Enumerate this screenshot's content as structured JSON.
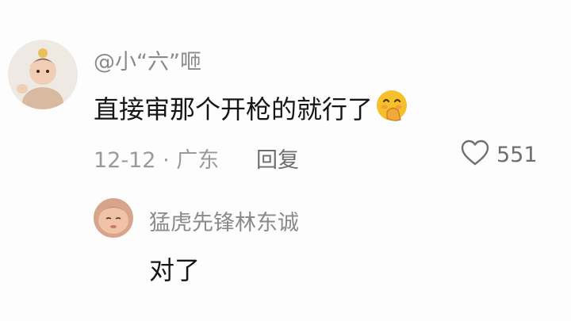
{
  "comment": {
    "username": "@小“六”咂",
    "text": "直接审那个开枪的就行了",
    "emoji": "face-with-hand-over-mouth-emoji",
    "date": "12-12",
    "separator": "·",
    "location": "广东",
    "reply_label": "回复",
    "like_count": "551"
  },
  "reply": {
    "username": "猛虎先锋林东诚",
    "text": "对了"
  },
  "colors": {
    "background": "#fdfdfd",
    "username": "#8a8a8a",
    "text": "#161616",
    "meta": "#9a9a9a",
    "emoji": "#f6c02b"
  }
}
